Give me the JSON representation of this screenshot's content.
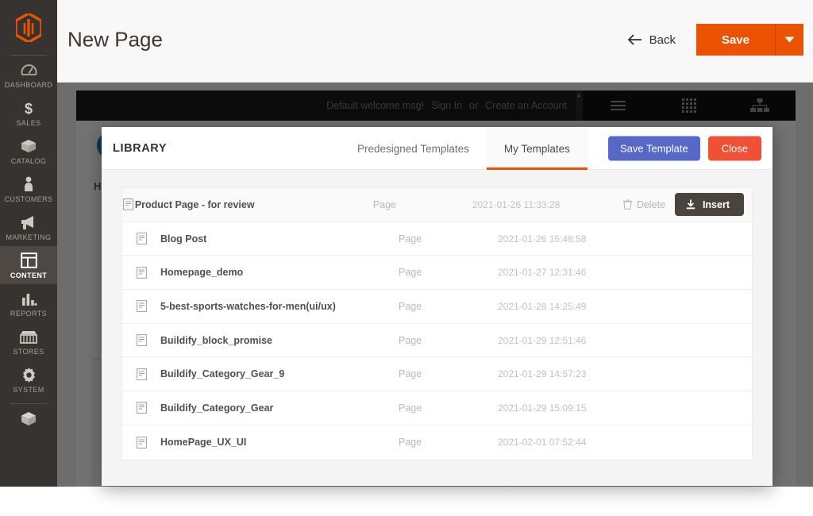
{
  "colors": {
    "accent_orange": "#eb5202",
    "sidebar_bg": "#373330",
    "save_template_blue": "#5868c8",
    "close_red": "#f05135",
    "insert_dark": "#4a443f"
  },
  "sidebar": {
    "logo_name": "magento-logo-icon",
    "items": [
      {
        "label": "DASHBOARD",
        "icon": "dashboard-icon",
        "active": false
      },
      {
        "label": "SALES",
        "icon": "dollar-icon",
        "active": false
      },
      {
        "label": "CATALOG",
        "icon": "box-icon",
        "active": false
      },
      {
        "label": "CUSTOMERS",
        "icon": "person-icon",
        "active": false
      },
      {
        "label": "MARKETING",
        "icon": "megaphone-icon",
        "active": false
      },
      {
        "label": "CONTENT",
        "icon": "layout-icon",
        "active": true
      },
      {
        "label": "REPORTS",
        "icon": "bar-chart-icon",
        "active": false
      },
      {
        "label": "STORES",
        "icon": "storefront-icon",
        "active": false
      },
      {
        "label": "SYSTEM",
        "icon": "gear-icon",
        "active": false
      }
    ],
    "footer_icon": "extensions-cube-icon"
  },
  "header": {
    "title": "New Page",
    "back_label": "Back",
    "back_icon": "arrow-left-icon",
    "save_label": "Save",
    "save_caret_icon": "caret-down-icon"
  },
  "canvas": {
    "storefront": {
      "welcome_msg": "Default welcome msg!",
      "sign_in": "Sign In",
      "or": "or",
      "create_account": "Create an Account",
      "icons": [
        "hamburger-menu-icon",
        "grid-icon",
        "sitemap-icon"
      ],
      "logo_name": "luma-store-logo",
      "nav_label": "Home"
    }
  },
  "modal": {
    "title": "LIBRARY",
    "tabs": [
      {
        "label": "Predesigned Templates",
        "active": false
      },
      {
        "label": "My Templates",
        "active": true
      }
    ],
    "save_template_label": "Save Template",
    "close_label": "Close",
    "row_actions": {
      "delete_label": "Delete",
      "delete_icon": "trash-icon",
      "insert_label": "Insert",
      "insert_icon": "download-arrow-icon"
    },
    "rows": [
      {
        "icon": "file-page-icon",
        "name": "Product Page - for review",
        "type": "Page",
        "date": "2021-01-26 11:33:28",
        "hovered": true
      },
      {
        "icon": "file-page-icon",
        "name": "Blog Post",
        "type": "Page",
        "date": "2021-01-26 15:48:58",
        "hovered": false
      },
      {
        "icon": "file-page-icon",
        "name": "Homepage_demo",
        "type": "Page",
        "date": "2021-01-27 12:31:46",
        "hovered": false
      },
      {
        "icon": "file-page-icon",
        "name": "5-best-sports-watches-for-men(ui/ux)",
        "type": "Page",
        "date": "2021-01-28 14:25:49",
        "hovered": false
      },
      {
        "icon": "file-page-icon",
        "name": "Buildify_block_promise",
        "type": "Page",
        "date": "2021-01-29 12:51:46",
        "hovered": false
      },
      {
        "icon": "file-page-icon",
        "name": "Buildify_Category_Gear_9",
        "type": "Page",
        "date": "2021-01-29 14:57:23",
        "hovered": false
      },
      {
        "icon": "file-page-icon",
        "name": "Buildify_Category_Gear",
        "type": "Page",
        "date": "2021-01-29 15:09:15",
        "hovered": false
      },
      {
        "icon": "file-page-icon",
        "name": "HomePage_UX_UI",
        "type": "Page",
        "date": "2021-02-01 07:52:44",
        "hovered": false
      }
    ]
  }
}
